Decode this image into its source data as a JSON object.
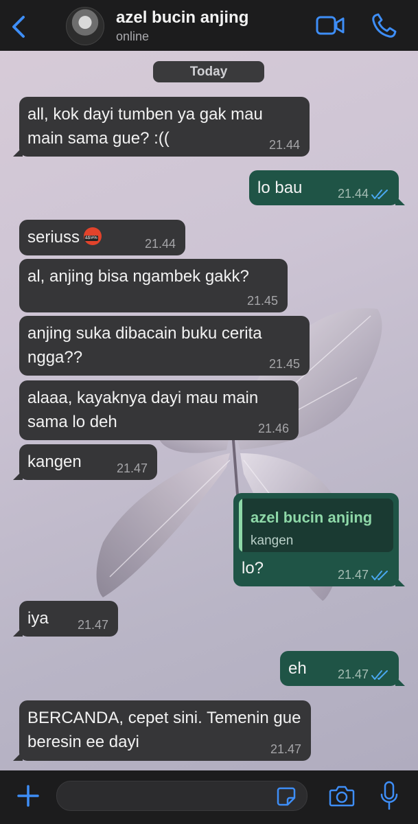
{
  "header": {
    "back_icon": "chevron-left-icon",
    "contact_name": "azel bucin anjing",
    "status": "online",
    "accent": "#3e8ef7"
  },
  "day_label": "Today",
  "messages": [
    {
      "direction": "in",
      "text": "all, kok dayi tumben ya gak mau main sama gue? :((",
      "time": "21.44"
    },
    {
      "direction": "out",
      "text": "lo bau",
      "time": "21.44",
      "status": "read"
    },
    {
      "direction": "in",
      "text": "seriuss",
      "emoji": "face-with-symbols-on-mouth",
      "time": "21.44"
    },
    {
      "direction": "in",
      "text": "al, anjing bisa ngambek gakk?",
      "time": "21.45"
    },
    {
      "direction": "in",
      "text": "anjing suka dibacain buku cerita ngga??",
      "time": "21.45"
    },
    {
      "direction": "in",
      "text": "alaaa, kayaknya dayi mau main sama lo deh",
      "time": "21.46"
    },
    {
      "direction": "in",
      "text": "kangen",
      "time": "21.47"
    },
    {
      "direction": "out",
      "reply_name": "azel bucin anjing",
      "reply_text": "kangen",
      "text": "lo?",
      "time": "21.47",
      "status": "read"
    },
    {
      "direction": "in",
      "text": "iya",
      "time": "21.47"
    },
    {
      "direction": "out",
      "text": "eh",
      "time": "21.47",
      "status": "read"
    },
    {
      "direction": "in",
      "text": "BERCANDA, cepet sini. Temenin gue beresin ee dayi",
      "time": "21.47"
    }
  ],
  "composer": {
    "plus_icon": "plus-icon",
    "sticker_icon": "sticker-icon",
    "camera_icon": "camera-icon",
    "mic_icon": "microphone-icon"
  },
  "colors": {
    "incoming_bubble": "#363638",
    "outgoing_bubble": "#1f5446",
    "read_ticks": "#4aa8f0",
    "bar_background": "#1c1c1d"
  }
}
